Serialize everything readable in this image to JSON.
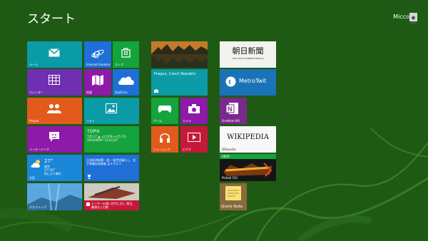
{
  "start_title": "スタート",
  "user_name": "Micco",
  "tiles": {
    "mail": {
      "label": "メール",
      "color": "#0a9ba6",
      "icon": "mail-icon"
    },
    "ie": {
      "label": "Internet Explorer",
      "color": "#1e6fd8",
      "icon": "internet-explorer-icon"
    },
    "store": {
      "label": "ストア",
      "color": "#14a33c",
      "icon": "store-icon"
    },
    "calendar": {
      "label": "カレンダー",
      "color": "#6f2fb1",
      "icon": "calendar-icon"
    },
    "maps": {
      "label": "地図",
      "color": "#8d1aa8",
      "icon": "maps-icon"
    },
    "skydrive": {
      "label": "SkyDrive",
      "color": "#1e6fd8",
      "icon": "cloud-icon"
    },
    "people": {
      "label": "People",
      "color": "#e25a1c",
      "icon": "people-icon"
    },
    "photos": {
      "label": "フォト",
      "color": "#0a9ba6",
      "icon": "photos-icon"
    },
    "messaging": {
      "label": "メッセージング",
      "color": "#8d1aa8",
      "icon": "messaging-icon"
    },
    "finance": {
      "color": "#14a33c",
      "heading": "TOPIX",
      "line1": "725.17 ▲ +2.22% (+15.71)",
      "line2": "2012/09/07 15:03 JST"
    },
    "weather": {
      "color": "#1a87d8",
      "temp": "27°",
      "place": "東京",
      "range": "27°/22°",
      "cond": "所により晴れ",
      "label": "天気"
    },
    "news": {
      "color": "#1e6fd8",
      "headline": "日本経済新聞・週一 経営会議もし、女子実験記録調査 足キボエツ"
    },
    "desktop": {
      "label": "デスクトップ",
      "color": "#2a7cc9"
    },
    "sports": {
      "color": "#c6193a",
      "headline": "レーサーの遠い世代に対し 周辺、最適な入力数"
    },
    "photo_wide": {
      "color": "#3a4a2a"
    },
    "travel": {
      "color": "#0a9ba6",
      "place": "Prague, Czech Republic"
    },
    "games": {
      "label": "ゲーム",
      "color": "#14a33c",
      "icon": "gamepad-icon"
    },
    "camera": {
      "label": "カメラ",
      "color": "#8d1aa8",
      "icon": "camera-icon"
    },
    "music": {
      "label": "ミュージック",
      "color": "#e25a1c",
      "icon": "headphones-icon"
    },
    "video": {
      "label": "ビデオ",
      "color": "#c6193a",
      "icon": "video-icon"
    },
    "asahi": {
      "title": "朝日新聞",
      "subtitle": "THE ASAHI SHIMBUN DIGITAL",
      "color": "#f2f2ee"
    },
    "metrotwit": {
      "label": "MetroTwit",
      "color": "#1a73b8"
    },
    "onenote": {
      "label": "OneNote MX",
      "color": "#7a2a8a"
    },
    "wikipedia": {
      "title": "WIKIPEDIA",
      "label": "Wikipedia",
      "color": "#f8f8f8"
    },
    "xbox": {
      "label": "XBOX",
      "color": "#14a33c"
    },
    "pinball": {
      "label": "Pinball FX2",
      "color": "#101010"
    },
    "quicknote": {
      "label": "Quick Note",
      "color": "#8a6a3a"
    }
  }
}
